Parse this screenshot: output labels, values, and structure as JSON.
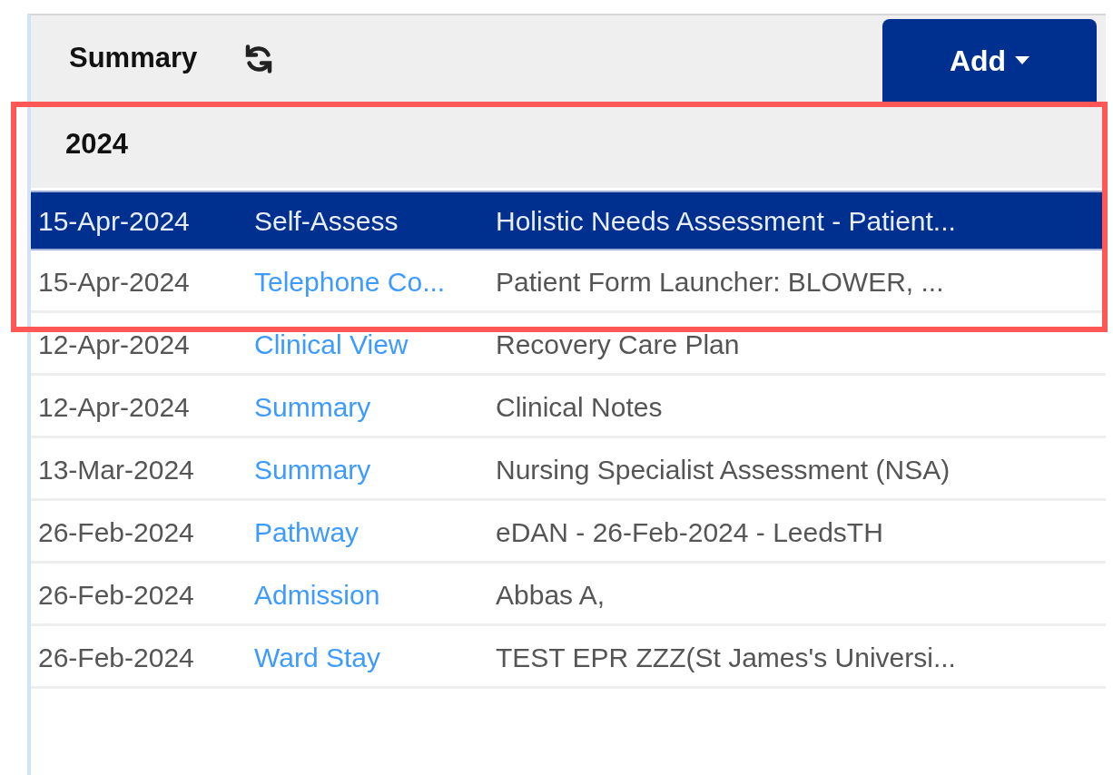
{
  "header": {
    "title": "Summary",
    "add_button": "Add"
  },
  "groups": [
    {
      "year": "2024",
      "rows": [
        {
          "date": "15-Apr-2024",
          "type": "Self-Assess",
          "description": "Holistic Needs Assessment - Patient...",
          "selected": true
        },
        {
          "date": "15-Apr-2024",
          "type": "Telephone Co...",
          "description": "Patient Form Launcher: BLOWER, ...",
          "selected": false
        },
        {
          "date": "12-Apr-2024",
          "type": "Clinical View",
          "description": "Recovery Care Plan",
          "selected": false
        },
        {
          "date": "12-Apr-2024",
          "type": "Summary",
          "description": "Clinical Notes",
          "selected": false
        },
        {
          "date": "13-Mar-2024",
          "type": "Summary",
          "description": "Nursing Specialist Assessment (NSA)",
          "selected": false
        },
        {
          "date": "26-Feb-2024",
          "type": "Pathway",
          "description": "eDAN - 26-Feb-2024 - LeedsTH",
          "selected": false
        },
        {
          "date": "26-Feb-2024",
          "type": "Admission",
          "description": "Abbas A,",
          "selected": false
        },
        {
          "date": "26-Feb-2024",
          "type": "Ward Stay",
          "description": "TEST EPR ZZZ(St James's Universi...",
          "selected": false
        }
      ]
    }
  ],
  "annotation": {
    "kind": "highlight-box"
  }
}
